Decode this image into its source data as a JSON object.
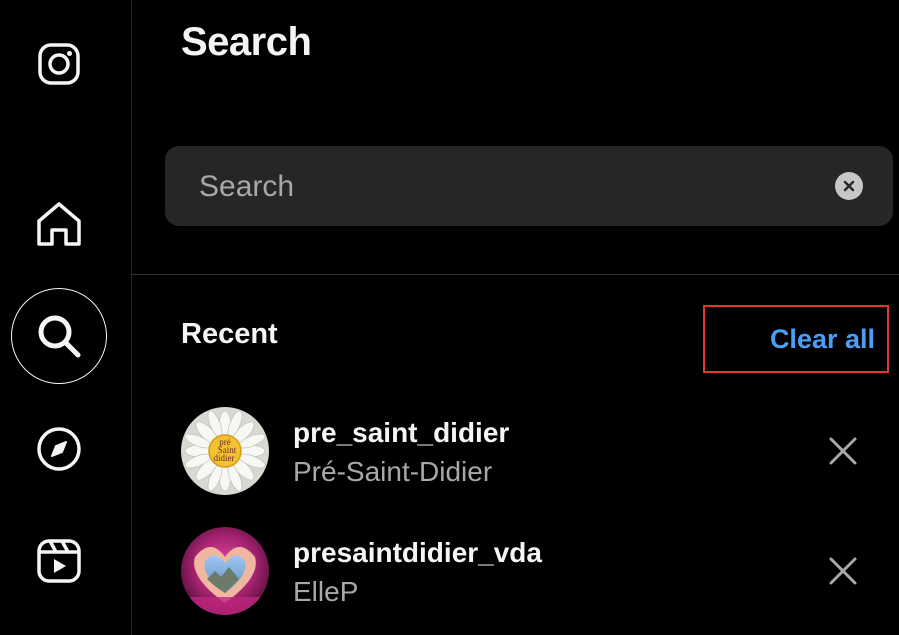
{
  "header": {
    "title": "Search"
  },
  "search": {
    "placeholder": "Search",
    "value": ""
  },
  "recent": {
    "label": "Recent",
    "clear_all_label": "Clear all",
    "items": [
      {
        "username": "pre_saint_didier",
        "fullname": "Pré-Saint-Didier",
        "avatar_text": [
          "pré",
          "Saint",
          "didier"
        ]
      },
      {
        "username": "presaintdidier_vda",
        "fullname": "ElleP"
      }
    ]
  },
  "icons": {
    "logo": "instagram-icon",
    "home": "home-icon",
    "search": "search-icon",
    "explore": "compass-icon",
    "reels": "reels-icon",
    "clear_input": "clear-circle-icon",
    "remove": "close-icon"
  },
  "colors": {
    "background": "#000000",
    "panel_input": "#262626",
    "link": "#4a9ff5",
    "highlight_border": "#e0392b",
    "secondary_text": "#a8a8a8"
  }
}
